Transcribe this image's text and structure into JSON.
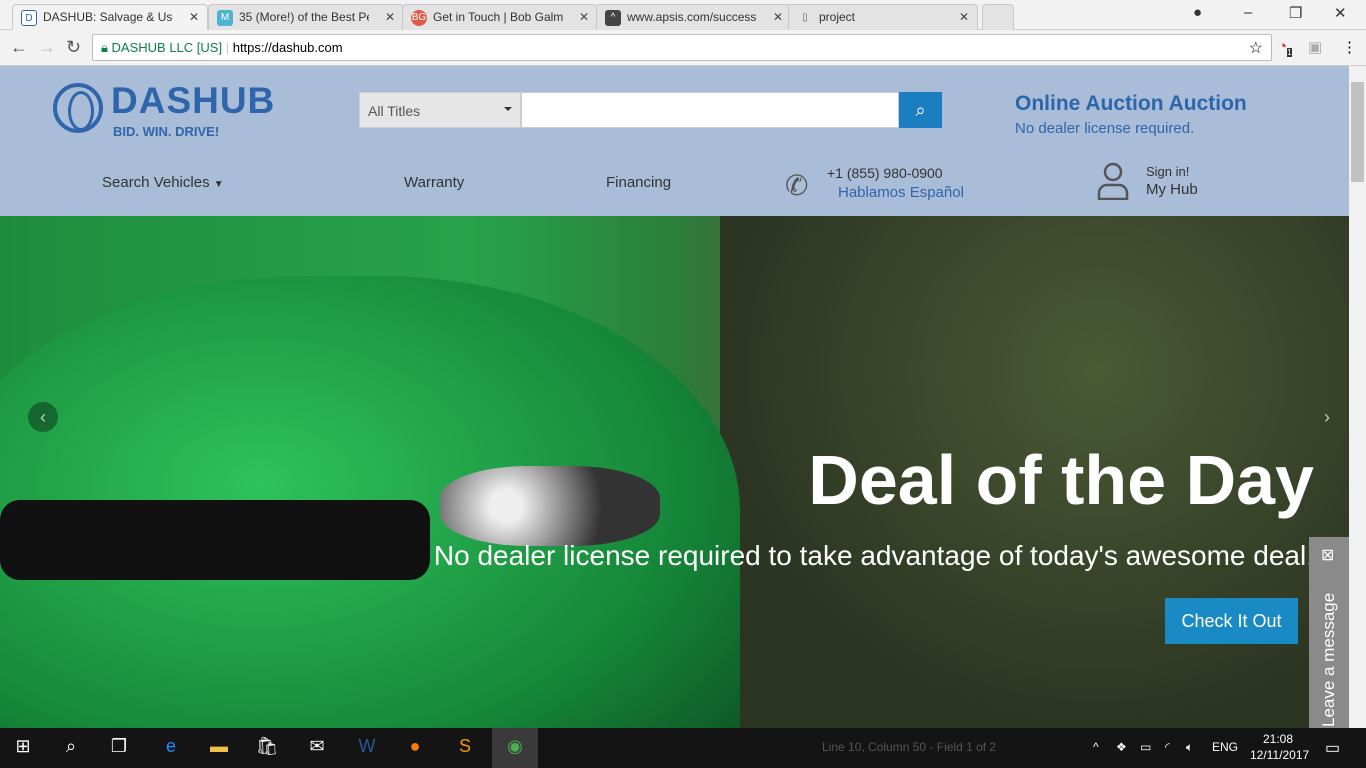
{
  "browser": {
    "tabs": [
      {
        "label": "DASHUB: Salvage & Used",
        "fav": "D",
        "color": "#ffffff"
      },
      {
        "label": "35 (More!) of the Best Pe",
        "fav": "M",
        "color": "#4fb3cf"
      },
      {
        "label": "Get in Touch | Bob Galma",
        "fav": "BG",
        "color": "#e05a4a"
      },
      {
        "label": "www.apsis.com/success-",
        "fav": "^",
        "color": "#444444"
      },
      {
        "label": "project",
        "fav": "▯",
        "color": "#ffffff"
      }
    ],
    "secure_label": "DASHUB LLC [US]",
    "url": "https://dashub.com",
    "ext_badge": "1"
  },
  "site": {
    "logo": {
      "name": "DASHUB",
      "tagline": "BID. WIN. DRIVE!"
    },
    "search": {
      "filter": "All Titles",
      "value": ""
    },
    "auction": {
      "title": "Online Auction Auction",
      "subtitle": "No dealer license required."
    },
    "menu": {
      "search_vehicles": "Search Vehicles",
      "warranty": "Warranty",
      "financing": "Financing"
    },
    "phone": {
      "number": "+1 (855) 980-0900",
      "spanish": "Hablamos Español"
    },
    "account": {
      "signin": "Sign in!",
      "myhub": "My Hub"
    },
    "hero": {
      "title": "Deal of the Day",
      "subtitle": "No dealer license required to take advantage of today's awesome deal.",
      "cta": "Check It Out"
    },
    "chat": {
      "label": "Leave a message"
    }
  },
  "taskbar": {
    "lang": "ENG",
    "time": "21:08",
    "date": "12/11/2017",
    "behind_text": "Line 10, Column 50 - Field 1 of 2"
  }
}
